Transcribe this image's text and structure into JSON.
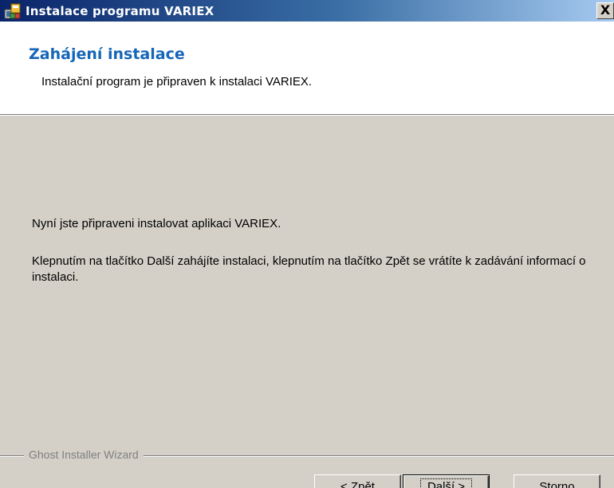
{
  "window": {
    "title": "Instalace programu VARIEX",
    "close_glyph": "X"
  },
  "header": {
    "heading": "Zahájení instalace",
    "subheading": "Instalační program je připraven k instalaci VARIEX."
  },
  "content": {
    "paragraph1": "Nyní jste připraveni instalovat aplikaci VARIEX.",
    "paragraph2": "Klepnutím na tlačítko Další zahájíte instalaci, klepnutím na tlačítko Zpět se vrátíte k zadávání informací o instalaci."
  },
  "footer": {
    "group_label": "Ghost Installer Wizard"
  },
  "buttons": {
    "back": {
      "prefix": "< ",
      "mnemonic": "Z",
      "rest": "pět"
    },
    "next": {
      "mnemonic": "D",
      "rest": "alší >"
    },
    "cancel": {
      "mnemonic": "S",
      "rest": "torno"
    }
  },
  "icons": {
    "app": "installer-icon",
    "close": "close-icon"
  },
  "colors": {
    "title_gradient_start": "#0a246a",
    "title_gradient_end": "#a6caf0",
    "heading": "#1565b8",
    "dialog_face": "#d4d0c8",
    "group_label": "#808080"
  }
}
